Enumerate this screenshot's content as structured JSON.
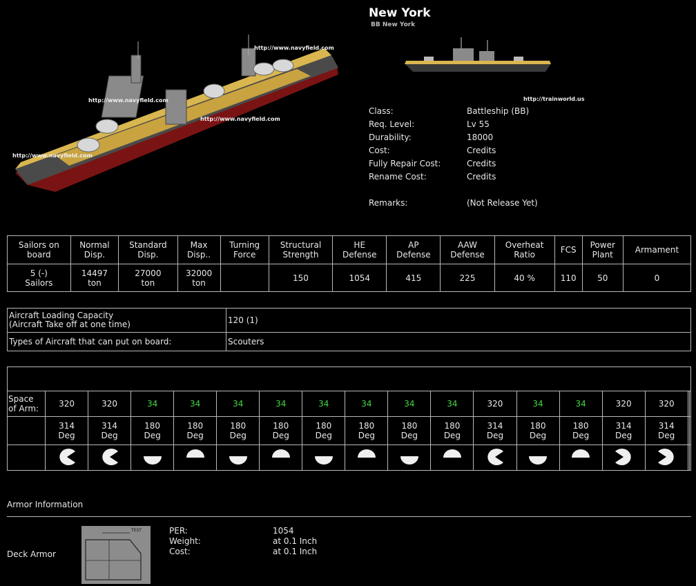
{
  "ship": {
    "name": "New York",
    "subtitle": "BB New York",
    "watermarks": [
      "http://www.navyfield.com",
      "http://www.navyfield.com",
      "http://www.navyfield.com",
      "http://www.navyfield.com"
    ],
    "site": "http://trainworld.us"
  },
  "info": [
    {
      "label": "Class:",
      "value": "Battleship (BB)"
    },
    {
      "label": "Req. Level:",
      "value": "Lv 55"
    },
    {
      "label": "Durability:",
      "value": "18000"
    },
    {
      "label": "Cost:",
      "value": "Credits"
    },
    {
      "label": "Fully Repair Cost:",
      "value": "Credits"
    },
    {
      "label": "Rename Cost:",
      "value": "Credits"
    },
    {
      "label": "Remarks:",
      "value": "(Not Release Yet)"
    }
  ],
  "stats": {
    "headers": [
      [
        "Sailors on",
        "board"
      ],
      [
        "Normal",
        "Disp."
      ],
      [
        "Standard",
        "Disp."
      ],
      [
        "Max",
        "Disp.."
      ],
      [
        "Turning",
        "Force"
      ],
      [
        "Structural",
        "Strength"
      ],
      [
        "HE",
        "Defense"
      ],
      [
        "AP",
        "Defense"
      ],
      [
        "AAW",
        "Defense"
      ],
      [
        "Overheat",
        "Ratio"
      ],
      [
        "FCS",
        ""
      ],
      [
        "Power",
        "Plant"
      ],
      [
        "Armament",
        ""
      ]
    ],
    "values": [
      [
        "5 (-)",
        "Sailors"
      ],
      [
        "14497",
        "ton"
      ],
      [
        "27000",
        "ton"
      ],
      [
        "32000",
        "ton"
      ],
      [
        "",
        ""
      ],
      [
        "150",
        ""
      ],
      [
        "1054",
        ""
      ],
      [
        "415",
        ""
      ],
      [
        "225",
        ""
      ],
      [
        "40 %",
        ""
      ],
      [
        "110",
        ""
      ],
      [
        "50",
        ""
      ],
      [
        "0",
        ""
      ]
    ]
  },
  "aircraft": {
    "capacity_label_1": "Aircraft Loading Capacity",
    "capacity_label_2": "(Aircraft Take off at one time)",
    "capacity_value": "120 (1)",
    "types_label": "Types of Aircraft that can put on board:",
    "types_value": "Scouters"
  },
  "arm": {
    "space_label_1": "Space",
    "space_label_2": "of Arm:",
    "slots": [
      {
        "space": "320",
        "deg": "314",
        "unit": "Deg",
        "green": false,
        "icon": "turret-right-icon"
      },
      {
        "space": "320",
        "deg": "314",
        "unit": "Deg",
        "green": false,
        "icon": "turret-right-icon"
      },
      {
        "space": "34",
        "deg": "180",
        "unit": "Deg",
        "green": true,
        "icon": "half-down-icon"
      },
      {
        "space": "34",
        "deg": "180",
        "unit": "Deg",
        "green": true,
        "icon": "half-up-icon"
      },
      {
        "space": "34",
        "deg": "180",
        "unit": "Deg",
        "green": true,
        "icon": "half-down-icon"
      },
      {
        "space": "34",
        "deg": "180",
        "unit": "Deg",
        "green": true,
        "icon": "half-up-icon"
      },
      {
        "space": "34",
        "deg": "180",
        "unit": "Deg",
        "green": true,
        "icon": "half-down-icon"
      },
      {
        "space": "34",
        "deg": "180",
        "unit": "Deg",
        "green": true,
        "icon": "half-up-icon"
      },
      {
        "space": "34",
        "deg": "180",
        "unit": "Deg",
        "green": true,
        "icon": "half-down-icon"
      },
      {
        "space": "34",
        "deg": "180",
        "unit": "Deg",
        "green": true,
        "icon": "half-up-icon"
      },
      {
        "space": "320",
        "deg": "314",
        "unit": "Deg",
        "green": false,
        "icon": "turret-right-icon"
      },
      {
        "space": "34",
        "deg": "180",
        "unit": "Deg",
        "green": true,
        "icon": "half-down-icon"
      },
      {
        "space": "34",
        "deg": "180",
        "unit": "Deg",
        "green": true,
        "icon": "half-up-icon"
      },
      {
        "space": "320",
        "deg": "314",
        "unit": "Deg",
        "green": false,
        "icon": "turret-left-icon"
      },
      {
        "space": "320",
        "deg": "314",
        "unit": "Deg",
        "green": false,
        "icon": "turret-left-icon"
      }
    ],
    "empty_slots": 2
  },
  "armor": {
    "title": "Armor Information",
    "deck_label": "Deck Armor",
    "schematic_text": "TEST",
    "rows": [
      {
        "label": "PER:",
        "value": "1054"
      },
      {
        "label": "Weight:",
        "value": "at 0.1 Inch"
      },
      {
        "label": "Cost:",
        "value": "at 0.1 Inch"
      }
    ]
  },
  "colors": {
    "background": "#000000",
    "text": "#e8e8e8",
    "border": "#b9b9b9",
    "green_value": "#44d644",
    "deck_yellow": "#e0c25a"
  }
}
